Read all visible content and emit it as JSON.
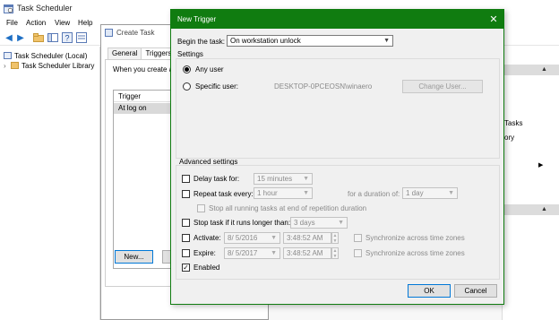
{
  "app": {
    "title": "Task Scheduler"
  },
  "menu": [
    "File",
    "Action",
    "View",
    "Help"
  ],
  "tree": {
    "root": "Task Scheduler (Local)",
    "library": "Task Scheduler Library"
  },
  "actions_pane": {
    "item1": "Tasks",
    "item2": "ory"
  },
  "create_task": {
    "title": "Create Task",
    "tabs": [
      "General",
      "Triggers"
    ],
    "intro": "When you create a",
    "list_header": "Trigger",
    "list_row": "At log on",
    "new_button": "New..."
  },
  "new_trigger": {
    "title": "New Trigger",
    "close_glyph": "✕",
    "begin_label": "Begin the task:",
    "begin_value": "On workstation unlock",
    "settings_label": "Settings",
    "any_user": "Any user",
    "specific_user": "Specific user:",
    "user_value": "DESKTOP-0PCEOSN\\winaero",
    "change_user": "Change User...",
    "advanced_label": "Advanced settings",
    "delay_label": "Delay task for:",
    "delay_value": "15 minutes",
    "repeat_label": "Repeat task every:",
    "repeat_value": "1 hour",
    "duration_label": "for a duration of:",
    "duration_value": "1 day",
    "stop_all_label": "Stop all running tasks at end of repetition duration",
    "stop_if_label": "Stop task if it runs longer than:",
    "stop_if_value": "3 days",
    "activate_label": "Activate:",
    "activate_date": "8/  5/2016",
    "activate_time": "3:48:52 AM",
    "expire_label": "Expire:",
    "expire_date": "8/  5/2017",
    "expire_time": "3:48:52 AM",
    "sync_label": "Synchronize across time zones",
    "enabled_label": "Enabled",
    "enabled_check": "✓",
    "ok": "OK",
    "cancel": "Cancel"
  },
  "colors": {
    "title_green": "#107c10",
    "focus_blue": "#0078d7"
  }
}
